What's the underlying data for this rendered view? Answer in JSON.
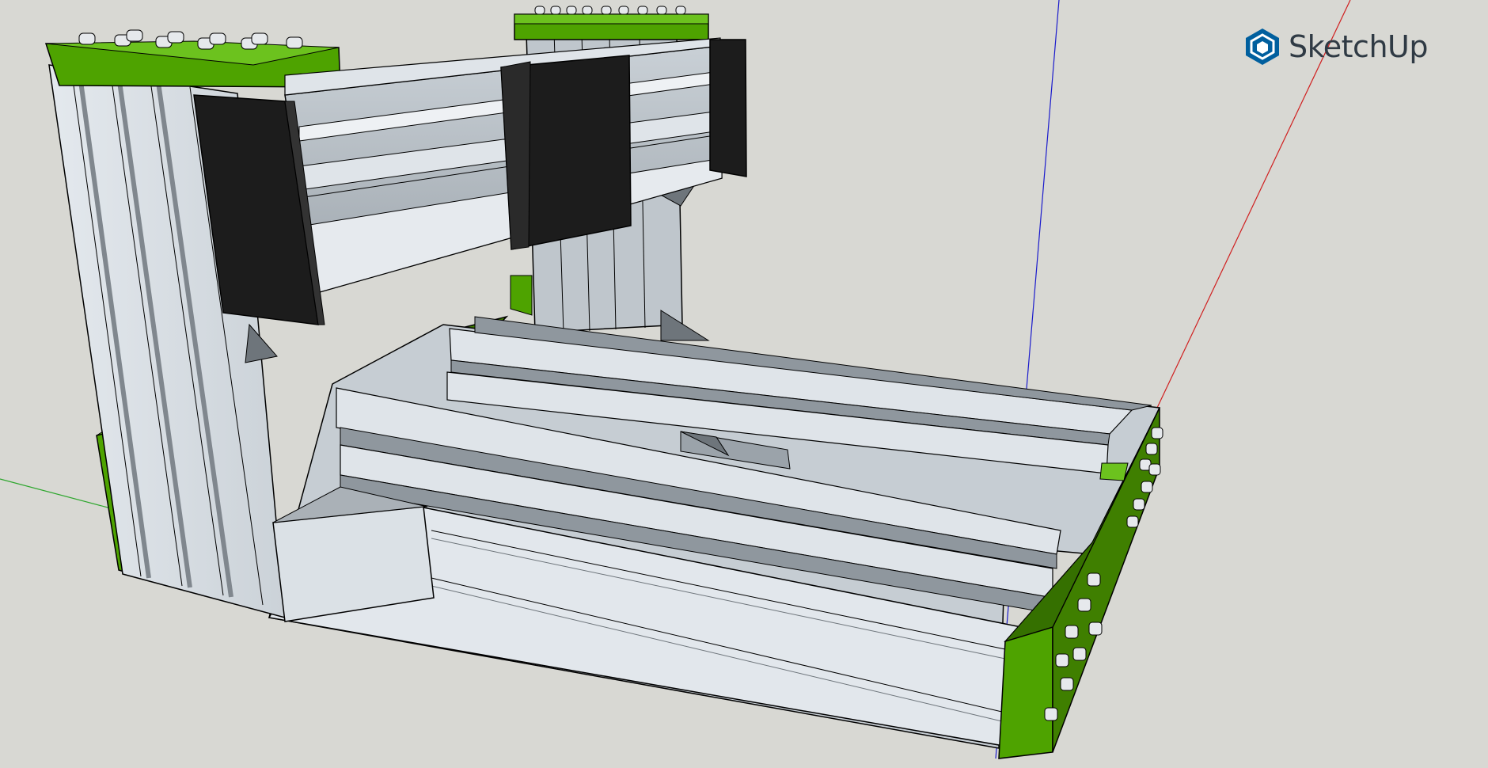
{
  "app": {
    "brand_name": "SketchUp",
    "logo_icon": "sketchup-logo-icon",
    "colors": {
      "background": "#d8d8d3",
      "brand": "#005f9e",
      "accent_green": "#4ea300",
      "axis_red": "#d01f1f",
      "axis_green": "#2ca62c",
      "axis_blue": "#1a1acc"
    }
  }
}
